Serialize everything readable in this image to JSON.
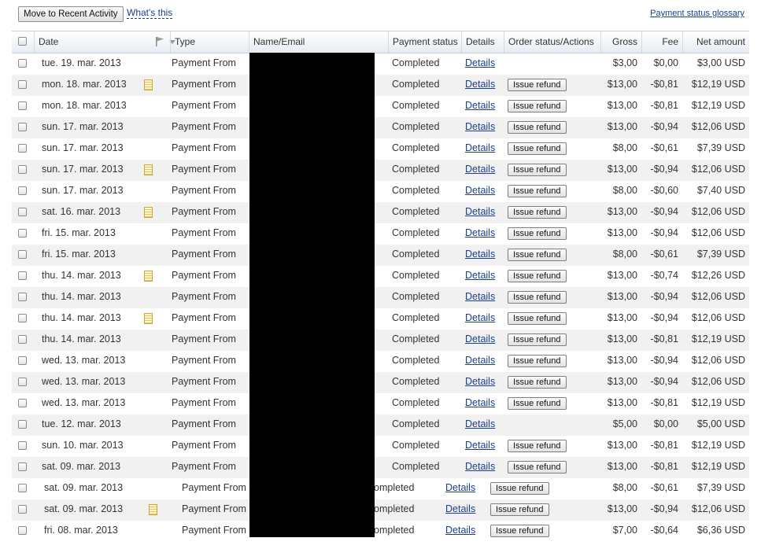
{
  "toolbar": {
    "move_label": "Move to Recent Activity",
    "whats_this": "What's this",
    "glossary": "Payment status glossary"
  },
  "headers": {
    "date": "Date",
    "type": "Type",
    "name": "Name/Email",
    "status": "Payment status",
    "details": "Details",
    "order": "Order status/Actions",
    "gross": "Gross",
    "fee": "Fee",
    "net": "Net amount"
  },
  "icons": {
    "flag": "flag-icon",
    "sort": "chevron-down-icon",
    "note": "note-icon"
  },
  "colors": {
    "link": "#1b3f8f",
    "row_alt": "#f1f1f1",
    "header_border": "#c9d2df"
  },
  "rows": [
    {
      "date": "tue. 19. mar. 2013",
      "note": false,
      "type": "Payment From",
      "status": "Completed",
      "details": "Details",
      "refund": "",
      "gross": "$3,00",
      "fee": "$0,00",
      "net": "$3,00 USD"
    },
    {
      "date": "mon. 18. mar. 2013",
      "note": true,
      "type": "Payment From",
      "status": "Completed",
      "details": "Details",
      "refund": "Issue refund",
      "gross": "$13,00",
      "fee": "-$0,81",
      "net": "$12,19 USD"
    },
    {
      "date": "mon. 18. mar. 2013",
      "note": false,
      "type": "Payment From",
      "status": "Completed",
      "details": "Details",
      "refund": "Issue refund",
      "gross": "$13,00",
      "fee": "-$0,81",
      "net": "$12,19 USD"
    },
    {
      "date": "sun. 17. mar. 2013",
      "note": false,
      "type": "Payment From",
      "status": "Completed",
      "details": "Details",
      "refund": "Issue refund",
      "gross": "$13,00",
      "fee": "-$0,94",
      "net": "$12,06 USD"
    },
    {
      "date": "sun. 17. mar. 2013",
      "note": false,
      "type": "Payment From",
      "status": "Completed",
      "details": "Details",
      "refund": "Issue refund",
      "gross": "$8,00",
      "fee": "-$0,61",
      "net": "$7,39 USD"
    },
    {
      "date": "sun. 17. mar. 2013",
      "note": true,
      "type": "Payment From",
      "status": "Completed",
      "details": "Details",
      "refund": "Issue refund",
      "gross": "$13,00",
      "fee": "-$0,94",
      "net": "$12,06 USD"
    },
    {
      "date": "sun. 17. mar. 2013",
      "note": false,
      "type": "Payment From",
      "status": "Completed",
      "details": "Details",
      "refund": "Issue refund",
      "gross": "$8,00",
      "fee": "-$0,60",
      "net": "$7,40 USD"
    },
    {
      "date": "sat. 16. mar. 2013",
      "note": true,
      "type": "Payment From",
      "status": "Completed",
      "details": "Details",
      "refund": "Issue refund",
      "gross": "$13,00",
      "fee": "-$0,94",
      "net": "$12,06 USD"
    },
    {
      "date": "fri. 15. mar. 2013",
      "note": false,
      "type": "Payment From",
      "status": "Completed",
      "details": "Details",
      "refund": "Issue refund",
      "gross": "$13,00",
      "fee": "-$0,94",
      "net": "$12,06 USD"
    },
    {
      "date": "fri. 15. mar. 2013",
      "note": false,
      "type": "Payment From",
      "status": "Completed",
      "details": "Details",
      "refund": "Issue refund",
      "gross": "$8,00",
      "fee": "-$0,61",
      "net": "$7,39 USD"
    },
    {
      "date": "thu. 14. mar. 2013",
      "note": true,
      "type": "Payment From",
      "status": "Completed",
      "details": "Details",
      "refund": "Issue refund",
      "gross": "$13,00",
      "fee": "-$0,74",
      "net": "$12,26 USD"
    },
    {
      "date": "thu. 14. mar. 2013",
      "note": false,
      "type": "Payment From",
      "status": "Completed",
      "details": "Details",
      "refund": "Issue refund",
      "gross": "$13,00",
      "fee": "-$0,94",
      "net": "$12,06 USD"
    },
    {
      "date": "thu. 14. mar. 2013",
      "note": true,
      "type": "Payment From",
      "status": "Completed",
      "details": "Details",
      "refund": "Issue refund",
      "gross": "$13,00",
      "fee": "-$0,94",
      "net": "$12,06 USD"
    },
    {
      "date": "thu. 14. mar. 2013",
      "note": false,
      "type": "Payment From",
      "status": "Completed",
      "details": "Details",
      "refund": "Issue refund",
      "gross": "$13,00",
      "fee": "-$0,81",
      "net": "$12,19 USD"
    },
    {
      "date": "wed. 13. mar. 2013",
      "note": false,
      "type": "Payment From",
      "status": "Completed",
      "details": "Details",
      "refund": "Issue refund",
      "gross": "$13,00",
      "fee": "-$0,94",
      "net": "$12,06 USD"
    },
    {
      "date": "wed. 13. mar. 2013",
      "note": false,
      "type": "Payment From",
      "status": "Completed",
      "details": "Details",
      "refund": "Issue refund",
      "gross": "$13,00",
      "fee": "-$0,94",
      "net": "$12,06 USD"
    },
    {
      "date": "wed. 13. mar. 2013",
      "note": false,
      "type": "Payment From",
      "status": "Completed",
      "details": "Details",
      "refund": "Issue refund",
      "gross": "$13,00",
      "fee": "-$0,81",
      "net": "$12,19 USD"
    },
    {
      "date": "tue. 12. mar. 2013",
      "note": false,
      "type": "Payment From",
      "status": "Completed",
      "details": "Details",
      "refund": "",
      "gross": "$5,00",
      "fee": "$0,00",
      "net": "$5,00 USD"
    },
    {
      "date": "sun. 10. mar. 2013",
      "note": false,
      "type": "Payment From",
      "status": "Completed",
      "details": "Details",
      "refund": "Issue refund",
      "gross": "$13,00",
      "fee": "-$0,81",
      "net": "$12,19 USD"
    },
    {
      "date": "sat. 09. mar. 2013",
      "note": false,
      "type": "Payment From",
      "status": "Completed",
      "details": "Details",
      "refund": "Issue refund",
      "gross": "$13,00",
      "fee": "-$0,81",
      "net": "$12,19 USD"
    },
    {
      "date": "sat. 09. mar. 2013",
      "note": false,
      "type": "Payment From",
      "status": "Completed",
      "details": "Details",
      "refund": "Issue refund",
      "gross": "$8,00",
      "fee": "-$0,61",
      "net": "$7,39 USD"
    },
    {
      "date": "sat. 09. mar. 2013",
      "note": true,
      "type": "Payment From",
      "status": "Completed",
      "details": "Details",
      "refund": "Issue refund",
      "gross": "$13,00",
      "fee": "-$0,94",
      "net": "$12,06 USD"
    },
    {
      "date": "fri. 08. mar. 2013",
      "note": false,
      "type": "Payment From",
      "status": "Completed",
      "details": "Details",
      "refund": "Issue refund",
      "gross": "$7,00",
      "fee": "-$0,64",
      "net": "$6,36 USD"
    }
  ]
}
